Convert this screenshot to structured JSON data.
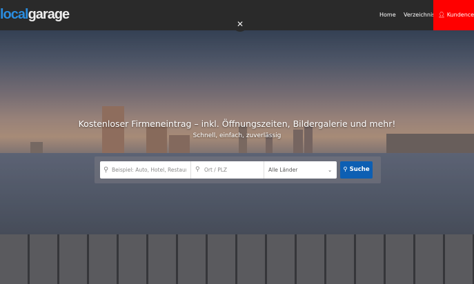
{
  "header": {
    "logo_part1": "local",
    "logo_part2": "garage",
    "nav": [
      {
        "label": "Home"
      },
      {
        "label": "Verzeichnis"
      }
    ],
    "account": {
      "label": "Kundencenter",
      "icon": "user-icon"
    },
    "close_icon": "close-icon"
  },
  "hero": {
    "title": "Kostenloser Firmeneintrag – inkl. Öffnungszeiten, Bildergalerie und mehr!",
    "subtitle": "Schnell, einfach, zuverlässig"
  },
  "search": {
    "query_placeholder": "Beispiel: Auto, Hotel, Restaurant,",
    "location_placeholder": "Ort / PLZ",
    "country_selected": "Alle Länder",
    "button_label": "Suche"
  },
  "colors": {
    "header_bg": "#2a2a2a",
    "accent_red": "#ff0000",
    "button_blue": "#0d5fb3",
    "logo_blue": "#2a8de0"
  }
}
